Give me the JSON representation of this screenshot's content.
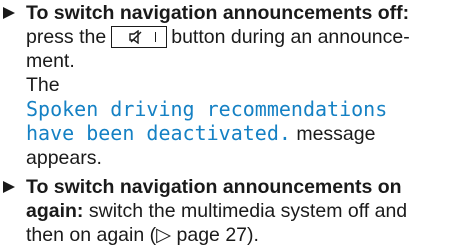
{
  "steps": [
    {
      "lines": [
        {
          "bold": "To switch navigation announcements off:"
        },
        {
          "pre": "press the",
          "post": "button during an announce-"
        },
        {
          "plain": "ment."
        },
        {
          "plain": "The"
        },
        {
          "mono": "Spoken driving recommendations"
        },
        {
          "mono": "have been deactivated.",
          "plain_after": "message"
        },
        {
          "plain": "appears."
        }
      ],
      "key_icon": "mute-speaker-icon"
    },
    {
      "lines": [
        {
          "bold": "To switch navigation announcements on"
        },
        {
          "bold": "again:",
          "plain_after": "switch the multimedia system off and"
        },
        {
          "plain": "then on again (▷ page 27)."
        }
      ]
    }
  ]
}
